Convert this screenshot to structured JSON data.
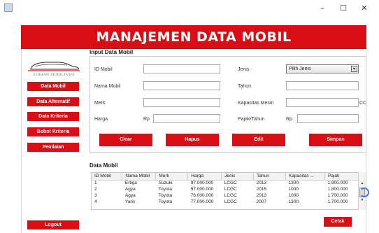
{
  "window": {
    "min_glyph": "–",
    "max_glyph": "☐",
    "close_glyph": "✕"
  },
  "header": {
    "title": "MANAJEMEN DATA MOBIL"
  },
  "logo": {
    "text": "SIDHAN MOBILINDO"
  },
  "sidebar": {
    "items": [
      {
        "label": "Data Mobil"
      },
      {
        "label": "Data Alternatif"
      },
      {
        "label": "Data Kriteria"
      },
      {
        "label": "Bobot Kriteria"
      },
      {
        "label": "Penilaian"
      }
    ],
    "logout_label": "Logout"
  },
  "form": {
    "section_title": "Input Data Mobil",
    "id_label": "ID Mobil",
    "nama_label": "Nama Mobil",
    "merk_label": "Merk",
    "harga_label": "Harga",
    "harga_prefix": "Rp",
    "jenis_label": "Jenis",
    "jenis_value": "Pilih Jenis",
    "tahun_label": "Tahun",
    "kapasitas_label": "Kapasitas Mesin",
    "kapasitas_unit": "CC",
    "pajak_label": "Pajak/Tahun",
    "pajak_prefix": "Rp"
  },
  "actions": {
    "clear": "Clear",
    "hapus": "Hapus",
    "edit": "Edit",
    "simpan": "Simpan"
  },
  "table": {
    "section_title": "Data Mobil",
    "columns": [
      "ID Mobil",
      "Nama Mobil",
      "Merk",
      "Harga",
      "Jenis",
      "Tahun",
      "Kapasitas ...",
      "Pajak"
    ],
    "rows": [
      [
        "1",
        "Ertiga",
        "Suzuki",
        "97.000.000",
        "LCGC",
        "2013",
        "1300",
        "1.900.000"
      ],
      [
        "2",
        "Agya",
        "Toyota",
        "97.000.000",
        "LCGC",
        "2015",
        "1000",
        "1.800.000"
      ],
      [
        "3",
        "Agya",
        "Toyota",
        "76.000.000",
        "LCGC",
        "2013",
        "1000",
        "1.700.000"
      ],
      [
        "4",
        "Yaris",
        "Toyota",
        "77.000.000",
        "LCGC",
        "2007",
        "1300",
        "1.700.000"
      ]
    ]
  },
  "footer": {
    "cetak_label": "Cetak"
  },
  "colors": {
    "accent": "#d90d14"
  }
}
